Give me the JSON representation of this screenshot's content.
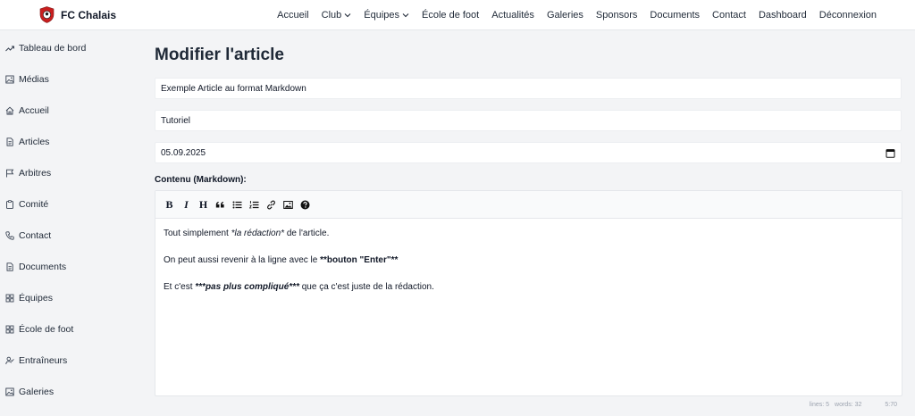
{
  "brand": {
    "name": "FC Chalais"
  },
  "nav": {
    "items": [
      {
        "label": "Accueil",
        "dropdown": false
      },
      {
        "label": "Club",
        "dropdown": true
      },
      {
        "label": "Équipes",
        "dropdown": true
      },
      {
        "label": "École de foot",
        "dropdown": false
      },
      {
        "label": "Actualités",
        "dropdown": false
      },
      {
        "label": "Galeries",
        "dropdown": false
      },
      {
        "label": "Sponsors",
        "dropdown": false
      },
      {
        "label": "Documents",
        "dropdown": false
      },
      {
        "label": "Contact",
        "dropdown": false
      },
      {
        "label": "Dashboard",
        "dropdown": false
      },
      {
        "label": "Déconnexion",
        "dropdown": false
      }
    ]
  },
  "sidebar": {
    "items": [
      {
        "label": "Tableau de bord",
        "icon": "trending-up-icon"
      },
      {
        "label": "Médias",
        "icon": "image-icon"
      },
      {
        "label": "Accueil",
        "icon": "home-icon"
      },
      {
        "label": "Articles",
        "icon": "document-icon"
      },
      {
        "label": "Arbitres",
        "icon": "flag-icon"
      },
      {
        "label": "Comité",
        "icon": "clipboard-icon"
      },
      {
        "label": "Contact",
        "icon": "phone-icon"
      },
      {
        "label": "Documents",
        "icon": "document-icon"
      },
      {
        "label": "Équipes",
        "icon": "grid-icon"
      },
      {
        "label": "École de foot",
        "icon": "grid-icon"
      },
      {
        "label": "Entraîneurs",
        "icon": "user-check-icon"
      },
      {
        "label": "Galeries",
        "icon": "image-icon"
      }
    ]
  },
  "main": {
    "title": "Modifier l'article",
    "title_field": {
      "value": "Exemple Article au format Markdown"
    },
    "category_field": {
      "value": "Tutoriel"
    },
    "date_field": {
      "value": "05.09.2025"
    },
    "content_label": "Contenu (Markdown):"
  },
  "editor": {
    "toolbar": [
      {
        "name": "bold",
        "label": "B"
      },
      {
        "name": "italic",
        "label": "I"
      },
      {
        "name": "heading",
        "label": "H"
      },
      {
        "name": "quote",
        "label": ""
      },
      {
        "name": "unordered-list",
        "label": ""
      },
      {
        "name": "ordered-list",
        "label": ""
      },
      {
        "name": "link",
        "label": ""
      },
      {
        "name": "image",
        "label": ""
      },
      {
        "name": "help",
        "label": ""
      }
    ],
    "lines": [
      {
        "pre": "Tout simplement ",
        "em": "*la rédaction*",
        "post": " de l'article."
      },
      {
        "pre": "On peut aussi revenir à la ligne avec le ",
        "strong": "**bouton \"Enter\"**",
        "post": ""
      },
      {
        "pre": "Et c'est ",
        "strong_em": "***pas plus compliqué***",
        "post": " que ça c'est juste de la rédaction."
      }
    ],
    "status": {
      "lines": "lines: 5",
      "words": "words: 32",
      "cursor": "5:70"
    }
  },
  "colors": {
    "sidebar_bg": "#f3f4f6",
    "brand_red": "#c81e1e",
    "text": "#1f2937"
  }
}
